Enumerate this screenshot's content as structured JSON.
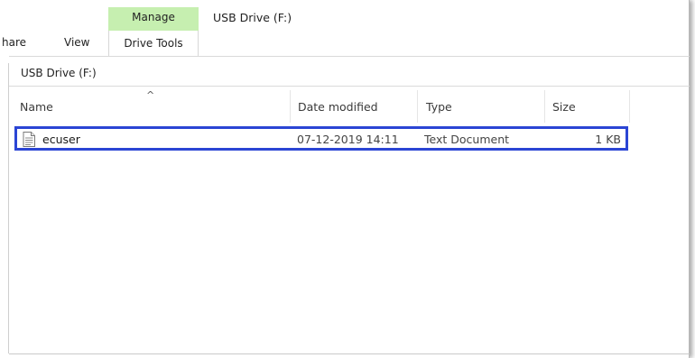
{
  "ribbon": {
    "tabs": [
      {
        "label": "hare"
      },
      {
        "label": "View"
      }
    ],
    "context_group": "Manage",
    "context_tab": "Drive Tools",
    "context_color": "#c6efb0"
  },
  "window": {
    "title": "USB Drive (F:)"
  },
  "address_bar": {
    "path": "USB Drive (F:)"
  },
  "columns": {
    "name": "Name",
    "date_modified": "Date modified",
    "type": "Type",
    "size": "Size",
    "sort_indicator": "^"
  },
  "files": [
    {
      "name": "ecuser",
      "date_modified": "07-12-2019 14:11",
      "type": "Text Document",
      "size": "1 KB",
      "icon": "text-document-icon"
    }
  ],
  "highlight_color": "#2b45d4"
}
